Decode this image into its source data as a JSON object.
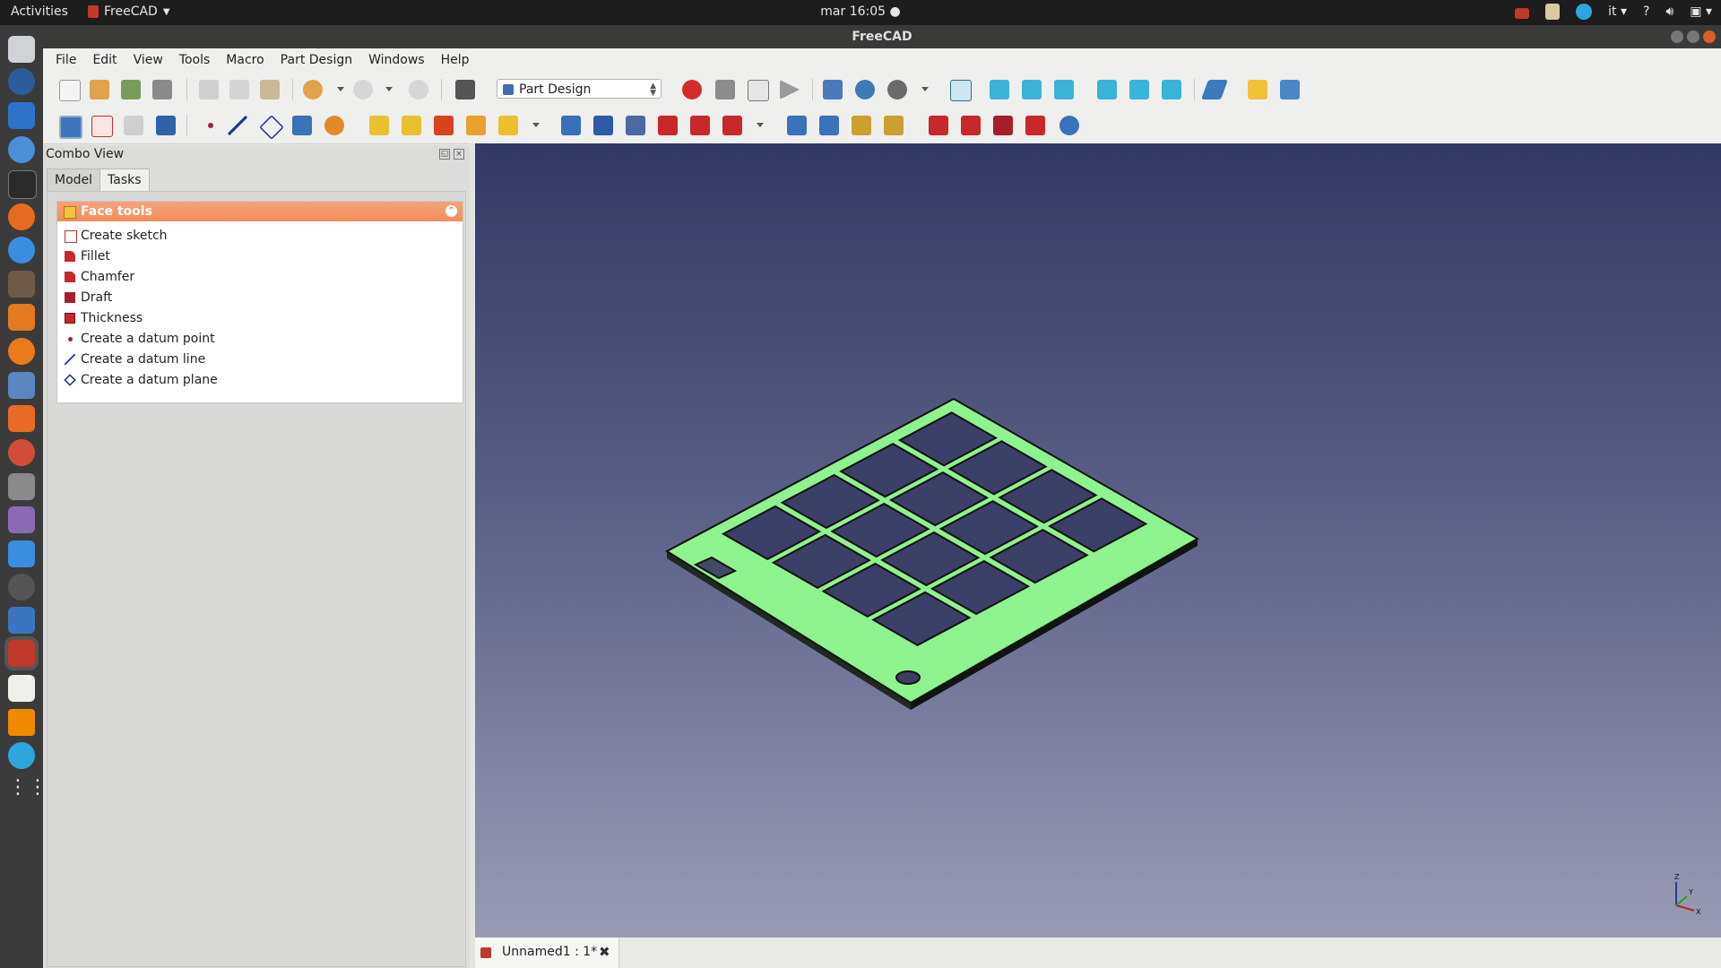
{
  "topbar": {
    "activities": "Activities",
    "app_name": "FreeCAD",
    "clock": "mar 16:05",
    "language": "it"
  },
  "window": {
    "title": "FreeCAD"
  },
  "menu": {
    "file": "File",
    "edit": "Edit",
    "view": "View",
    "tools": "Tools",
    "macro": "Macro",
    "part_design": "Part Design",
    "windows": "Windows",
    "help": "Help"
  },
  "toolbar": {
    "workbench": "Part Design"
  },
  "combo": {
    "title": "Combo View",
    "tab_model": "Model",
    "tab_tasks": "Tasks"
  },
  "face_tools": {
    "header": "Face tools",
    "items": [
      {
        "label": "Create sketch",
        "icon": "sketch-icon"
      },
      {
        "label": "Fillet",
        "icon": "fillet-icon"
      },
      {
        "label": "Chamfer",
        "icon": "chamfer-icon"
      },
      {
        "label": "Draft",
        "icon": "draft-icon"
      },
      {
        "label": "Thickness",
        "icon": "thickness-icon"
      },
      {
        "label": "Create a datum point",
        "icon": "datum-point-icon"
      },
      {
        "label": "Create a datum line",
        "icon": "datum-line-icon"
      },
      {
        "label": "Create a datum plane",
        "icon": "datum-plane-icon"
      }
    ]
  },
  "document_tab": {
    "label": "Unnamed1 : 1*"
  },
  "colors": {
    "model_fill": "#8ef28e",
    "background_top": "#333965",
    "background_bottom": "#9a9bb3",
    "task_header": "#f28e5c"
  }
}
